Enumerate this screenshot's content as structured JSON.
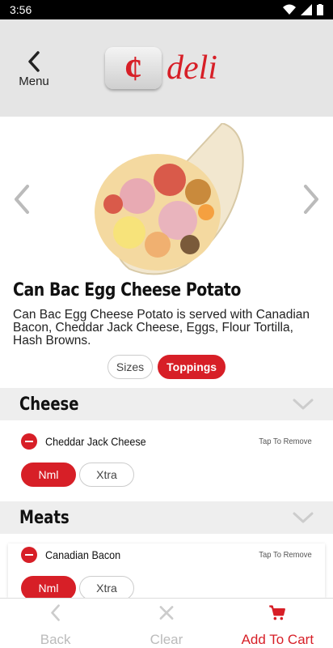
{
  "status": {
    "time": "3:56"
  },
  "header": {
    "menu_label": "Menu",
    "logo_mark": "¢",
    "logo_word": "deli"
  },
  "product": {
    "title": "Can Bac Egg Cheese Potato",
    "description": "Can Bac Egg Cheese Potato is served with Canadian Bacon, Cheddar Jack Cheese, Eggs, Flour Tortilla, Hash Browns."
  },
  "tabs": [
    {
      "label": "Sizes",
      "active": false
    },
    {
      "label": "Toppings",
      "active": true
    }
  ],
  "sections": [
    {
      "name": "Cheese",
      "items": [
        {
          "name": "Cheddar Jack Cheese",
          "action": "Tap To Remove",
          "options": [
            "Nml",
            "Xtra"
          ],
          "selected": "Nml"
        }
      ]
    },
    {
      "name": "Meats",
      "items": [
        {
          "name": "Canadian Bacon",
          "action": "Tap To Remove",
          "options": [
            "Nml",
            "Xtra"
          ],
          "selected": "Nml"
        }
      ]
    }
  ],
  "bottom_bar": {
    "back": "Back",
    "clear": "Clear",
    "add_to_cart": "Add To Cart"
  },
  "colors": {
    "accent": "#d71f27",
    "header_bg": "#e5e5e5",
    "section_bg": "#eeeeee"
  }
}
